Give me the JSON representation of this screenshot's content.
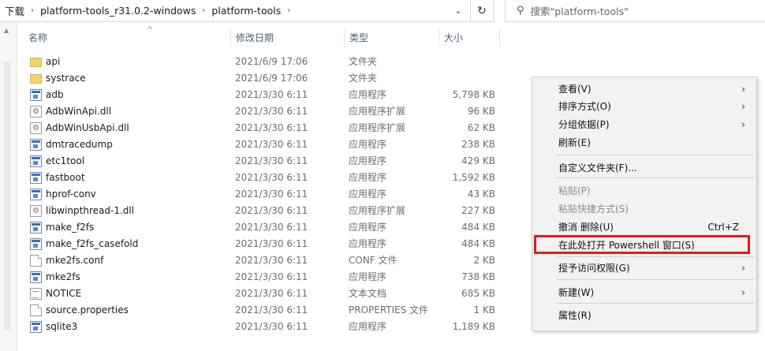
{
  "address": {
    "crumbs": [
      "下载",
      "platform-tools_r31.0.2-windows",
      "platform-tools"
    ],
    "separator": "›",
    "dropdown_glyph": "⌄",
    "refresh_glyph": "↻"
  },
  "search": {
    "placeholder": "搜索\"platform-tools\"",
    "icon": "search-icon"
  },
  "columns": {
    "name": "名称",
    "date": "修改日期",
    "type": "类型",
    "size": "大小"
  },
  "files": [
    {
      "name": "api",
      "date": "2021/6/9 17:06",
      "type": "文件夹",
      "size": "",
      "icon": "folder"
    },
    {
      "name": "systrace",
      "date": "2021/6/9 17:06",
      "type": "文件夹",
      "size": "",
      "icon": "folder"
    },
    {
      "name": "adb",
      "date": "2021/3/30 6:11",
      "type": "应用程序",
      "size": "5,798 KB",
      "icon": "exe"
    },
    {
      "name": "AdbWinApi.dll",
      "date": "2021/3/30 6:11",
      "type": "应用程序扩展",
      "size": "96 KB",
      "icon": "dll"
    },
    {
      "name": "AdbWinUsbApi.dll",
      "date": "2021/3/30 6:11",
      "type": "应用程序扩展",
      "size": "62 KB",
      "icon": "dll"
    },
    {
      "name": "dmtracedump",
      "date": "2021/3/30 6:11",
      "type": "应用程序",
      "size": "238 KB",
      "icon": "exe"
    },
    {
      "name": "etc1tool",
      "date": "2021/3/30 6:11",
      "type": "应用程序",
      "size": "429 KB",
      "icon": "exe"
    },
    {
      "name": "fastboot",
      "date": "2021/3/30 6:11",
      "type": "应用程序",
      "size": "1,592 KB",
      "icon": "exe"
    },
    {
      "name": "hprof-conv",
      "date": "2021/3/30 6:11",
      "type": "应用程序",
      "size": "43 KB",
      "icon": "exe"
    },
    {
      "name": "libwinpthread-1.dll",
      "date": "2021/3/30 6:11",
      "type": "应用程序扩展",
      "size": "227 KB",
      "icon": "dll"
    },
    {
      "name": "make_f2fs",
      "date": "2021/3/30 6:11",
      "type": "应用程序",
      "size": "484 KB",
      "icon": "exe"
    },
    {
      "name": "make_f2fs_casefold",
      "date": "2021/3/30 6:11",
      "type": "应用程序",
      "size": "484 KB",
      "icon": "exe"
    },
    {
      "name": "mke2fs.conf",
      "date": "2021/3/30 6:11",
      "type": "CONF 文件",
      "size": "2 KB",
      "icon": "file"
    },
    {
      "name": "mke2fs",
      "date": "2021/3/30 6:11",
      "type": "应用程序",
      "size": "738 KB",
      "icon": "exe"
    },
    {
      "name": "NOTICE",
      "date": "2021/3/30 6:11",
      "type": "文本文档",
      "size": "685 KB",
      "icon": "txt"
    },
    {
      "name": "source.properties",
      "date": "2021/3/30 6:11",
      "type": "PROPERTIES 文件",
      "size": "1 KB",
      "icon": "file"
    },
    {
      "name": "sqlite3",
      "date": "2021/3/30 6:11",
      "type": "应用程序",
      "size": "1,189 KB",
      "icon": "exe"
    }
  ],
  "context_menu": {
    "items": [
      {
        "label": "查看(V)",
        "submenu": true,
        "disabled": false,
        "accel": ""
      },
      {
        "label": "排序方式(O)",
        "submenu": true,
        "disabled": false,
        "accel": ""
      },
      {
        "label": "分组依据(P)",
        "submenu": true,
        "disabled": false,
        "accel": ""
      },
      {
        "label": "刷新(E)",
        "submenu": false,
        "disabled": false,
        "accel": ""
      },
      {
        "label": "自定义文件夹(F)...",
        "submenu": false,
        "disabled": false,
        "accel": ""
      },
      {
        "label": "粘贴(P)",
        "submenu": false,
        "disabled": true,
        "accel": ""
      },
      {
        "label": "粘贴快捷方式(S)",
        "submenu": false,
        "disabled": true,
        "accel": ""
      },
      {
        "label": "撤消 删除(U)",
        "submenu": false,
        "disabled": false,
        "accel": "Ctrl+Z"
      },
      {
        "label": "在此处打开 Powershell 窗口(S)",
        "submenu": false,
        "disabled": false,
        "accel": "",
        "highlighted": true
      },
      {
        "label": "授予访问权限(G)",
        "submenu": true,
        "disabled": false,
        "accel": ""
      },
      {
        "label": "新建(W)",
        "submenu": true,
        "disabled": false,
        "accel": ""
      },
      {
        "label": "属性(R)",
        "submenu": false,
        "disabled": false,
        "accel": ""
      }
    ],
    "submenu_glyph": "›",
    "highlight_color": "#e41b1b"
  }
}
